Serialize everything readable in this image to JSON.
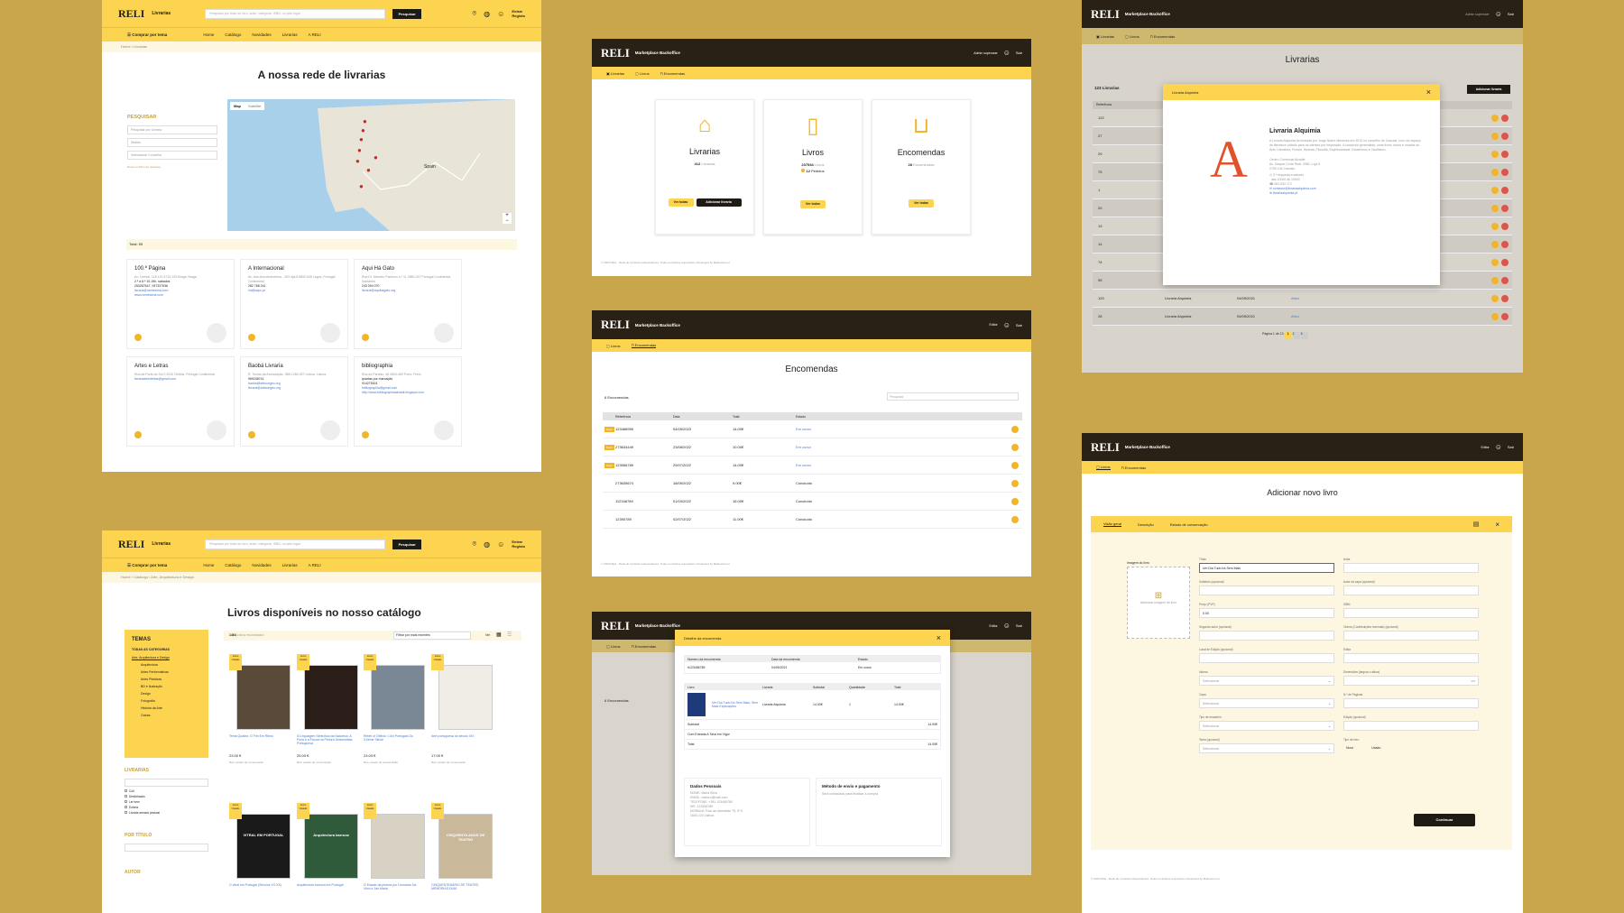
{
  "store": {
    "logo": "RELI",
    "sub": "Livrarias",
    "search_placeholder": "Pesquisar por título do livro, autor, categoria, ISBN, ou pelo lugar",
    "search_btn": "Pesquisar",
    "login": "Entrar",
    "register": "Registo",
    "shop_by_theme": "Comprar por tema",
    "nav": [
      "Home",
      "Catálogo",
      "Novidades",
      "Livrarias",
      "A RELI"
    ]
  },
  "s1": {
    "crumb": "Home / Livrarias",
    "title": "A nossa rede de livrarias",
    "search_label": "PESQUISAR",
    "filter1": "Pesquisar por Livraria",
    "filter2": "Distrito",
    "filter3": "Seleccionar Concelho",
    "clear": "Reset os filtros de pesquisa",
    "map_tab": "Map",
    "sat_tab": "Satellite",
    "map_label": "Spain",
    "total": "Total: 55",
    "cards": [
      {
        "name": "100.ª Página",
        "addr": "Av. Central, 118-120 4710-229 Braga, Braga",
        "hours": "2.ª a 6.ª 10-19h, sábados",
        "phone": "253267647, 937337936",
        "email": "livraria@centesima.com",
        "web": "www.centesima.com"
      },
      {
        "name": "A Internacional",
        "addr": "Av. dos descobrimentos - 303 loja 8 8600 645 Lagos, Portugal Continental",
        "hours": "",
        "phone": "282 788 241",
        "email": "int@sapo.pt",
        "web": ""
      },
      {
        "name": "Aqui Há Gato",
        "addr": "Rua Dr. Marcelo Pacheco n.º 11 2580-037 Portugal Continental, Santarém",
        "hours": "",
        "phone": "243 094 070",
        "email": "livraria@aquihagato.org",
        "web": ""
      },
      {
        "name": "Artes e Letras",
        "addr": "Rua da Porta do Sol 2 2510 Óbidos, Portugal Continental",
        "hours": "",
        "phone": "",
        "email": "livrariaartesletras@gmail.com",
        "web": ""
      },
      {
        "name": "Baobá Livraria",
        "addr": "R. Tomás da Anunciação, 28B 1350-327 Lisboa, Lisboa",
        "hours": "",
        "phone": "969248741",
        "email": "baoba@artisongeo.org",
        "web": "livraria@artisongeo.org"
      },
      {
        "name": "bibliographia",
        "addr": "Rua do Paraíso, 46 4000-469 Porto, Porto",
        "hours": "quartas por marcação",
        "phone": "914275301",
        "email": "bibliographia@gmail.com",
        "web": "http://www.bibliographiaabrasil.blogspot.com"
      }
    ]
  },
  "bo": {
    "logo": "RELI",
    "sub": "Marketplace Backoffice",
    "admin": "Admin superuser",
    "sair": "Sair",
    "editor": "Editor",
    "tabs": [
      "Livrarias",
      "Livros",
      "Encomendas"
    ]
  },
  "s2": {
    "c1": {
      "title": "Livrarias",
      "count": "412",
      "unit": "Livrarias",
      "b1": "Ver todas",
      "b2": "Adicionar livraria"
    },
    "c2": {
      "title": "Livros",
      "count": "237534",
      "unit": "Livros",
      "pending": "12",
      "pending_lbl": "Pedidos",
      "b1": "Ver todos"
    },
    "c3": {
      "title": "Encomendas",
      "count": "28",
      "unit": "Encomendas",
      "b1": "Ver todas"
    },
    "footer": "© 2023 RELI - Rede de Livrarias Independentes. Todos os direitos reservados. Developed by Makeweb.net"
  },
  "s3": {
    "title": "Livrarias",
    "count": "123 Livrarias",
    "add": "Adicionar livraria",
    "modal_hdr": "Livraria Alquimia",
    "modal_name": "Livraria Alquimia",
    "modal_letter": "A",
    "modal_desc": "A Livraria Alquimia foi fundada por Jorge Nobre Menezes em 2013 no concelho de Cascais, com um espaço de literatura voltado para os clientes por Inspiração. A curadoria generalista, onde livros novos e usados de Arte, Literatura, Poesia, História, Filosofia, Espiritualidade, Esoterismo e Ocultismo.",
    "modal_addr": "Centro Comercial Alcaide",
    "modal_addr2": "Av. Gaspar Corte Real, 2984, Loja 8",
    "modal_addr3": "2750 144 Cascais",
    "hours": "3.ª segunda a sábado",
    "hours2": "das 10h00 às 19h00",
    "phone": "963 832 172",
    "email": "contacto@livrariaalquimia.com",
    "web": "livrariaalquimia.pt",
    "ref": "Referência",
    "rows": [
      "122",
      "27",
      "29",
      "75",
      "1",
      "20",
      "13",
      "14",
      "74",
      "95",
      "120",
      "28"
    ],
    "row_name": "Livraria Alquimia",
    "row_date": "04/05/2021",
    "row_edit": "Ativo",
    "pager": "Página 1 de 13"
  },
  "s4": {
    "title": "Encomendas",
    "count": "6 Encomendas",
    "search": "Pesquisar",
    "heads": [
      "Referência",
      "Data",
      "Total",
      "Estado"
    ],
    "rows": [
      {
        "badge": "Novo",
        "ref": "123488959",
        "date": "04/05/2023",
        "total": "14.00€",
        "state": "Em curso"
      },
      {
        "badge": "Novo",
        "ref": "273634449",
        "date": "23/08/2022",
        "total": "10.00€",
        "state": "Em curso"
      },
      {
        "badge": "Novo",
        "ref": "123566789",
        "date": "25/07/2022",
        "total": "14.00€",
        "state": "Em curso"
      },
      {
        "badge": "",
        "ref": "273635674",
        "date": "18/05/2022",
        "total": "9.00€",
        "state": "Concluído"
      },
      {
        "badge": "",
        "ref": "112346789",
        "date": "01/03/2022",
        "total": "16.00€",
        "state": "Concluído"
      },
      {
        "badge": "",
        "ref": "12390789",
        "date": "02/07/2022",
        "total": "11.00€",
        "state": "Concluído"
      }
    ]
  },
  "s5": {
    "crumb": "Home / Catálogo / Arte, Arquitectura e Design",
    "title": "Livros disponíveis no nosso catálogo",
    "count": "1464",
    "count_lbl": "Livros encontrados",
    "sort": "Filtrar por mais recentes",
    "ver": "Ver",
    "themes": "TEMAS",
    "all_cats": "TODAS AS CATEGORIAS",
    "cat_active": "Arte, Arquitectura e Design",
    "cats": [
      "Arquitectura",
      "Artes Performativas",
      "Artes Plásticas",
      "BD e Ilustração",
      "Design",
      "Fotografia",
      "História da Arte",
      "Outras"
    ],
    "shops_lbl": "LIVRARIAS",
    "shops": [
      "Cult",
      "Desfolhados",
      "Ler bem",
      "Euforia",
      "Livraria armario pessoal"
    ],
    "title_lbl": "POR TÍTULO",
    "author_lbl": "AUTOR",
    "badge": "Livro Usado",
    "cond": "Bom estado de conservação",
    "books": [
      {
        "title": "Tema Quadro: O Fim Em Ritmo",
        "price": "23.00 €"
      },
      {
        "title": "A Linguagem Simbólica da Natureza: A Flora e a Fauna na Pintura Seiscentista Portuguesa",
        "price": "25.00 €"
      },
      {
        "title": "Rebel of Oblivio: L'Art Portugais Du XXème Siècle",
        "price": "23.00 €"
      },
      {
        "title": "Arte portuguesa do século XIX",
        "price": "17.00 €"
      },
      {
        "title": "O vitral em Portugal (Séculos XV-XX)",
        "price": ""
      },
      {
        "title": "Arquitectura barroca em Portugal",
        "price": ""
      },
      {
        "title": "O Estado da pintura por Leonardo Da Vinci e Jan Maria",
        "price": ""
      },
      {
        "title": "CINQUENTENÁRIO DE TEATRO MEMÓRIAS DUM",
        "price": ""
      }
    ],
    "cover_text": [
      "",
      "",
      "",
      "",
      "VITRAL EM PORTUGAL",
      "Arquitectura barroca",
      "",
      "CINQUENTA ANOS DE TEATRO"
    ]
  },
  "s6": {
    "modal_title": "Detalhe da encomenda",
    "th": [
      "Número da encomenda",
      "Data da encomenda",
      "Estado"
    ],
    "num": "#123456789",
    "date": "04/05/2021",
    "state": "Em curso",
    "lh": [
      "Livro",
      "Livraria",
      "Subtotal",
      "Quantidade",
      "Total"
    ],
    "book": "Um Dia Tudo Irá Sem Mais, Sem Mais Explicações",
    "shop": "Livraria Alquimia",
    "sub": "14.00€",
    "qty": "1",
    "tot": "14.00€",
    "subtotal_lbl": "Subtotal",
    "subtotal": "14.00€",
    "ship_lbl": "Com Entrada A Taxa em Vigor",
    "total_lbl": "Total",
    "total": "14.00€",
    "pers_hdr": "Dados Pessoais",
    "pers": [
      "NOME: Maria Silva",
      "EMAIL: maria.s@mail.com",
      "TELEFONE: +351 123456789",
      "NIF: 123456789",
      "MORADA: Rua da Liberdade 75, 3º E",
      "1600-123 Lisboa"
    ],
    "pay_hdr": "Método de envio e pagamento",
    "pay": "Será contactado para finalizar a compra",
    "list_count": "6 Encomendas"
  },
  "s7": {
    "title": "Adicionar novo livro",
    "tabs": [
      "Visão geral",
      "Descrição",
      "Estado de conservação"
    ],
    "img_lbl": "Imagem do livro",
    "img_btn": "Adicionar imagem do livro",
    "fields_l": [
      "Título",
      "Subtítulo (opcional)",
      "Preço (PVP)",
      "Segundo autor (opcional)",
      "Local de Edição (opcional)",
      "Idioma",
      "Capa",
      "Tipo de encadern.",
      "Tema (opcional)"
    ],
    "fields_r": [
      "Autor",
      "Autor da capa (opcional)",
      "ISBN",
      "Outros (Contribuições nominais) (opcional)",
      "Editor",
      "Dimensões (largura x altura)",
      "N.º de Páginas",
      "Edição (opcional)",
      "Tipo de livro"
    ],
    "title_val": "Um Dia Tudo Irá Sem Mais",
    "price_val": "0.00",
    "select": "Seleccionar",
    "dim_unit": "cm",
    "radio1": "Novo",
    "radio2": "Usado",
    "continue": "Continuar"
  }
}
